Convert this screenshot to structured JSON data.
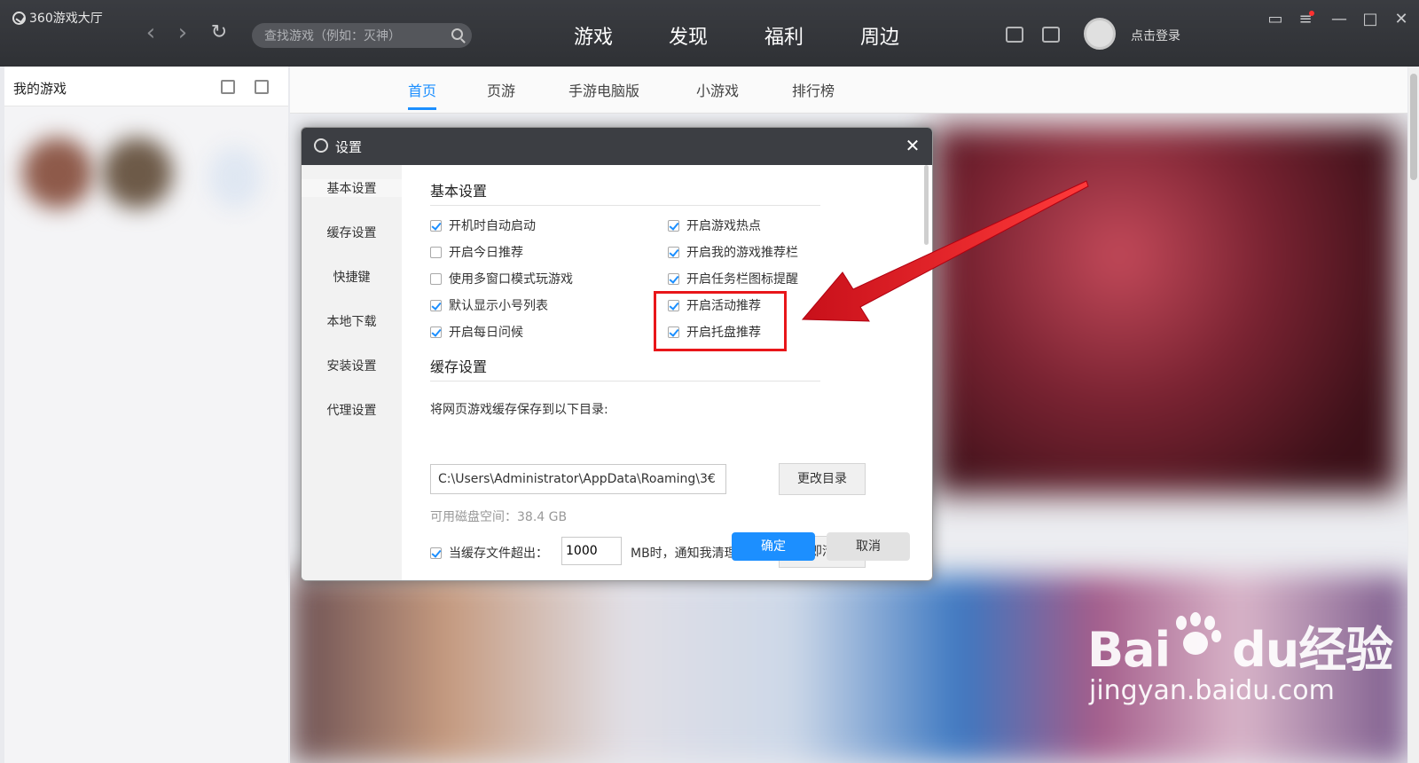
{
  "app": {
    "title": "360游戏大厅"
  },
  "search": {
    "placeholder": "查找游戏（例如：灭神）"
  },
  "main_tabs": [
    {
      "label": "游戏",
      "active": true
    },
    {
      "label": "发现",
      "active": false
    },
    {
      "label": "福利",
      "active": false
    },
    {
      "label": "周边",
      "active": false
    }
  ],
  "user": {
    "login_label": "点击登录"
  },
  "left_panel": {
    "title": "我的游戏"
  },
  "sub_tabs": [
    {
      "label": "首页",
      "active": true
    },
    {
      "label": "页游",
      "active": false
    },
    {
      "label": "手游电脑版",
      "active": false
    },
    {
      "label": "小游戏",
      "active": false
    },
    {
      "label": "排行榜",
      "active": false
    }
  ],
  "dialog": {
    "title": "设置",
    "sidebar": [
      "基本设置",
      "缓存设置",
      "快捷键",
      "本地下载",
      "安装设置",
      "代理设置"
    ],
    "basic_section": "基本设置",
    "left_options": [
      {
        "label": "开机时自动启动",
        "checked": true
      },
      {
        "label": "开启今日推荐",
        "checked": false
      },
      {
        "label": "使用多窗口模式玩游戏",
        "checked": false
      },
      {
        "label": "默认显示小号列表",
        "checked": true
      },
      {
        "label": "开启每日问候",
        "checked": true
      }
    ],
    "right_options": [
      {
        "label": "开启游戏热点",
        "checked": true
      },
      {
        "label": "开启我的游戏推荐栏",
        "checked": true
      },
      {
        "label": "开启任务栏图标提醒",
        "checked": true
      },
      {
        "label": "开启活动推荐",
        "checked": true
      },
      {
        "label": "开启托盘推荐",
        "checked": true
      }
    ],
    "cache_section": "缓存设置",
    "cache_dir_label": "将网页游戏缓存保存到以下目录:",
    "cache_dir_value": "C:\\Users\\Administrator\\AppData\\Roaming\\3€",
    "change_dir_button": "更改目录",
    "disk_space": "可用磁盘空间：38.4 GB",
    "cache_limit_label": "当缓存文件超出：",
    "cache_limit_checked": true,
    "cache_limit_value": "1000",
    "cache_limit_suffix": "MB时，通知我清理",
    "clear_button": "立即清理",
    "ok_button": "确定",
    "cancel_button": "取消"
  },
  "watermark": {
    "brand": "Bai",
    "brand2": "du",
    "brand_cn": "经验",
    "url": "jingyan.baidu.com"
  },
  "colors": {
    "accent": "#1c8fff",
    "highlight": "#e8161a",
    "titlebar": "#3c3e43"
  }
}
